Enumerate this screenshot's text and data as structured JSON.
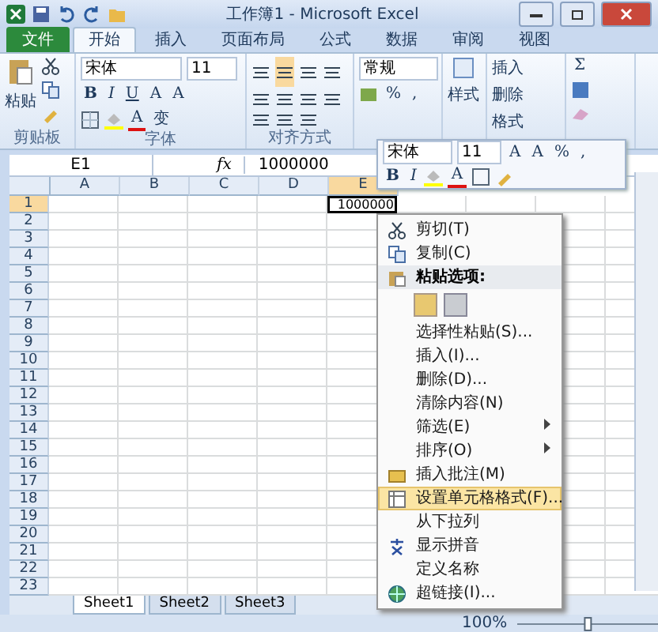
{
  "window": {
    "title": "工作簿1 - Microsoft Excel"
  },
  "ribbon_tabs": [
    {
      "label": "文件",
      "kind": "file",
      "selected": false
    },
    {
      "label": "开始",
      "kind": "tab",
      "selected": true
    },
    {
      "label": "插入",
      "kind": "tab",
      "selected": false
    },
    {
      "label": "页面布局",
      "kind": "tab",
      "selected": false
    },
    {
      "label": "公式",
      "kind": "tab",
      "selected": false
    },
    {
      "label": "数据",
      "kind": "tab",
      "selected": false
    },
    {
      "label": "审阅",
      "kind": "tab",
      "selected": false
    },
    {
      "label": "视图",
      "kind": "tab",
      "selected": false
    }
  ],
  "ribbon": {
    "clipboard": {
      "paste": "粘贴",
      "label": "剪贴板"
    },
    "font": {
      "name": "宋体",
      "size": "11",
      "bold": "B",
      "italic": "I",
      "underline": "U",
      "grow": "A",
      "shrink": "A",
      "font_color": "A",
      "phonetic": "变",
      "label": "字体"
    },
    "alignment": {
      "label": "对齐方式"
    },
    "number": {
      "format": "常规",
      "percent": "%",
      "comma": ","
    },
    "styles": {
      "label": "样式"
    },
    "cells": {
      "insert": "插入",
      "delete": "删除",
      "format": "格式"
    },
    "editing": {
      "sum": "Σ"
    }
  },
  "formula_bar": {
    "name_box": "E1",
    "function_label": "fx",
    "value": "1000000"
  },
  "sheet": {
    "columns": [
      {
        "label": "A",
        "selected": false
      },
      {
        "label": "B",
        "selected": false
      },
      {
        "label": "C",
        "selected": false
      },
      {
        "label": "D",
        "selected": false
      },
      {
        "label": "E",
        "selected": true
      }
    ],
    "rows": [
      {
        "label": "1",
        "selected": true
      },
      {
        "label": "2",
        "selected": false
      },
      {
        "label": "3",
        "selected": false
      },
      {
        "label": "4",
        "selected": false
      },
      {
        "label": "5",
        "selected": false
      },
      {
        "label": "6",
        "selected": false
      },
      {
        "label": "7",
        "selected": false
      },
      {
        "label": "8",
        "selected": false
      },
      {
        "label": "9",
        "selected": false
      },
      {
        "label": "10",
        "selected": false
      },
      {
        "label": "11",
        "selected": false
      },
      {
        "label": "12",
        "selected": false
      },
      {
        "label": "13",
        "selected": false
      },
      {
        "label": "14",
        "selected": false
      },
      {
        "label": "15",
        "selected": false
      },
      {
        "label": "16",
        "selected": false
      },
      {
        "label": "17",
        "selected": false
      },
      {
        "label": "18",
        "selected": false
      },
      {
        "label": "19",
        "selected": false
      },
      {
        "label": "20",
        "selected": false
      },
      {
        "label": "21",
        "selected": false
      },
      {
        "label": "22",
        "selected": false
      },
      {
        "label": "23",
        "selected": false
      }
    ],
    "active_cell": {
      "value": "1000000"
    }
  },
  "mini_toolbar": {
    "font": "宋体",
    "size": "11",
    "grow": "A",
    "shrink": "A",
    "percent": "%",
    "comma": ",",
    "bold": "B",
    "italic": "I",
    "font_color": "A"
  },
  "context_menu": [
    {
      "kind": "item",
      "label": "剪切(T)",
      "selected": false,
      "submenu": false
    },
    {
      "kind": "item",
      "label": "复制(C)",
      "selected": false,
      "submenu": false
    },
    {
      "kind": "header",
      "label": "粘贴选项:"
    },
    {
      "kind": "paste_options"
    },
    {
      "kind": "item",
      "label": "选择性粘贴(S)...",
      "selected": false,
      "submenu": false
    },
    {
      "kind": "item",
      "label": "插入(I)...",
      "selected": false,
      "submenu": false
    },
    {
      "kind": "item",
      "label": "删除(D)...",
      "selected": false,
      "submenu": false
    },
    {
      "kind": "item",
      "label": "清除内容(N)",
      "selected": false,
      "submenu": false
    },
    {
      "kind": "item",
      "label": "筛选(E)",
      "selected": false,
      "submenu": true
    },
    {
      "kind": "item",
      "label": "排序(O)",
      "selected": false,
      "submenu": true
    },
    {
      "kind": "item",
      "label": "插入批注(M)",
      "selected": false,
      "submenu": false
    },
    {
      "kind": "item",
      "label": "设置单元格格式(F)...",
      "selected": true,
      "submenu": false
    },
    {
      "kind": "item",
      "label": "从下拉列",
      "selected": false,
      "submenu": false
    },
    {
      "kind": "item",
      "label": "显示拼音",
      "selected": false,
      "submenu": false
    },
    {
      "kind": "item",
      "label": "定义名称",
      "selected": false,
      "submenu": false
    },
    {
      "kind": "item",
      "label": "超链接(I)...",
      "selected": false,
      "submenu": false
    }
  ],
  "sheet_tabs": [
    {
      "label": "Sheet1",
      "selected": true
    },
    {
      "label": "Sheet2",
      "selected": false
    },
    {
      "label": "Sheet3",
      "selected": false
    }
  ],
  "status_bar": {
    "zoom": "100%"
  }
}
